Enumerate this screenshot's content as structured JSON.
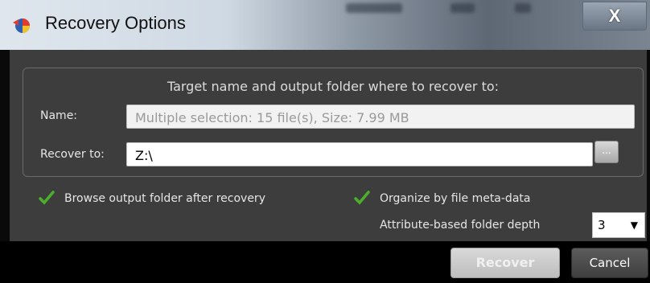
{
  "window": {
    "title": "Recovery Options",
    "close_glyph": "X"
  },
  "group": {
    "legend": "Target name and output folder where to recover to:"
  },
  "name_field": {
    "label": "Name:",
    "value": "Multiple selection: 15 file(s), Size: 7.99 MB"
  },
  "recover_to": {
    "label": "Recover to:",
    "value": "Z:\\",
    "browse_label": "..."
  },
  "options": {
    "browse_output": {
      "label": "Browse output folder after recovery",
      "checked": true
    },
    "organize_meta": {
      "label": "Organize by file meta-data",
      "checked": true
    },
    "folder_depth": {
      "label": "Attribute-based folder depth",
      "value": "3"
    }
  },
  "buttons": {
    "recover": "Recover",
    "cancel": "Cancel"
  },
  "icons": {
    "app": "recovery-app-icon",
    "check": "checkmark-icon",
    "dropdown": "chevron-down-icon"
  },
  "colors": {
    "dialog_bg": "#3d3d3d",
    "footer_bg": "#000000",
    "check_green": "#4caf2a"
  }
}
